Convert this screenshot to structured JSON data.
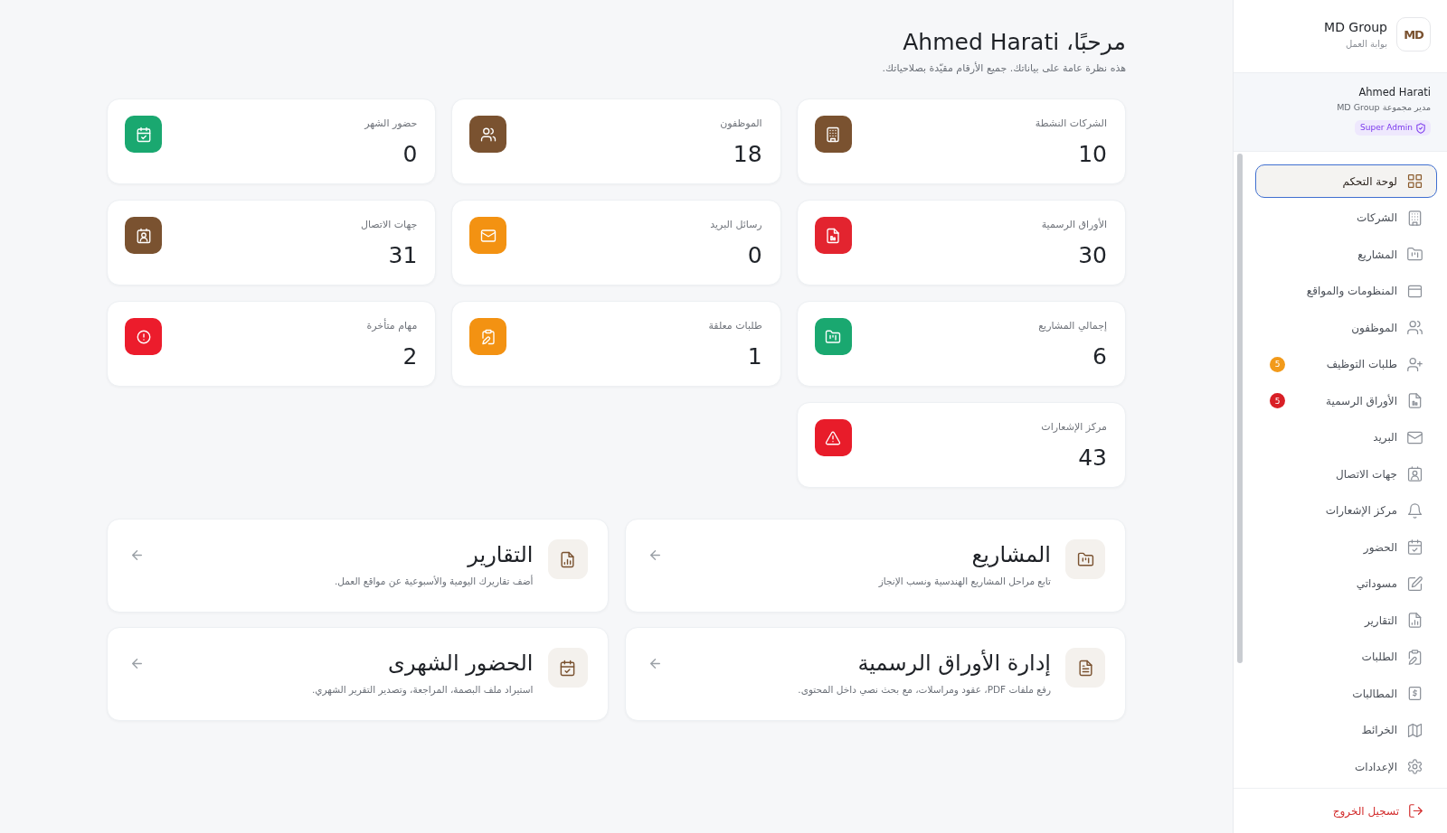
{
  "sidebar": {
    "brand": {
      "logo_text": "MD",
      "name": "MD Group",
      "subtitle": "بوابة العمل"
    },
    "user": {
      "name": "Ahmed Harati",
      "role": "مدير مجموعة MD Group",
      "badge": "Super Admin"
    },
    "nav_items": [
      {
        "label": "لوحة التحكم",
        "selected": true
      },
      {
        "label": "الشركات",
        "selected": false
      },
      {
        "label": "المشاريع",
        "selected": false
      },
      {
        "label": "المنظومات والمواقع",
        "selected": false
      },
      {
        "label": "الموظفون",
        "selected": false
      },
      {
        "label": "طلبات التوظيف",
        "selected": false,
        "badge": {
          "text": "5",
          "color": "#f29a1a"
        }
      },
      {
        "label": "الأوراق الرسمية",
        "selected": false,
        "badge": {
          "text": "5",
          "color": "#d91f26"
        }
      },
      {
        "label": "البريد",
        "selected": false
      },
      {
        "label": "جهات الاتصال",
        "selected": false
      },
      {
        "label": "مركز الإشعارات",
        "selected": false
      },
      {
        "label": "الحضور",
        "selected": false
      },
      {
        "label": "مسوداتي",
        "selected": false
      },
      {
        "label": "التقارير",
        "selected": false
      },
      {
        "label": "الطلبات",
        "selected": false
      },
      {
        "label": "المطالبات",
        "selected": false
      },
      {
        "label": "الخرائط",
        "selected": false
      },
      {
        "label": "الإعدادات",
        "selected": false
      }
    ],
    "logout": "تسجيل الخروج"
  },
  "header": {
    "title": "مرحبًا، Ahmed Harati",
    "subtitle": "هذه نظرة عامة على بياناتك. جميع الأرقام مقيّدة بصلاحياتك."
  },
  "stats": [
    {
      "label": "الشركات النشطة",
      "value": "10",
      "color": "#7a5230"
    },
    {
      "label": "الموظفون",
      "value": "18",
      "color": "#7a5230"
    },
    {
      "label": "حضور الشهر",
      "value": "0",
      "color": "#1aa870"
    },
    {
      "label": "الأوراق الرسمية",
      "value": "30",
      "color": "#e3242f"
    },
    {
      "label": "رسائل البريد",
      "value": "0",
      "color": "#f39212"
    },
    {
      "label": "جهات الاتصال",
      "value": "31",
      "color": "#7a5230"
    },
    {
      "label": "إجمالي المشاريع",
      "value": "6",
      "color": "#1aa870"
    },
    {
      "label": "طلبات معلقة",
      "value": "1",
      "color": "#f39212"
    },
    {
      "label": "مهام متأخرة",
      "value": "2",
      "color": "#ec1c2c"
    },
    {
      "label": "مركز الإشعارات",
      "value": "43",
      "color": "#e81c2a"
    }
  ],
  "shortcuts": [
    {
      "title": "المشاريع",
      "description": "تابع مراحل المشاريع الهندسية ونسب الإنجاز"
    },
    {
      "title": "التقارير",
      "description": "أضف تقاريرك اليومية والأسبوعية عن مواقع العمل."
    },
    {
      "title": "إدارة الأوراق الرسمية",
      "description": "رفع ملفات PDF، عقود ومراسلات، مع بحث نصي داخل المحتوى."
    },
    {
      "title": "الحضور الشهرى",
      "description": "استيراد ملف البصمة، المراجعة، وتصدير التقرير الشهري."
    }
  ]
}
